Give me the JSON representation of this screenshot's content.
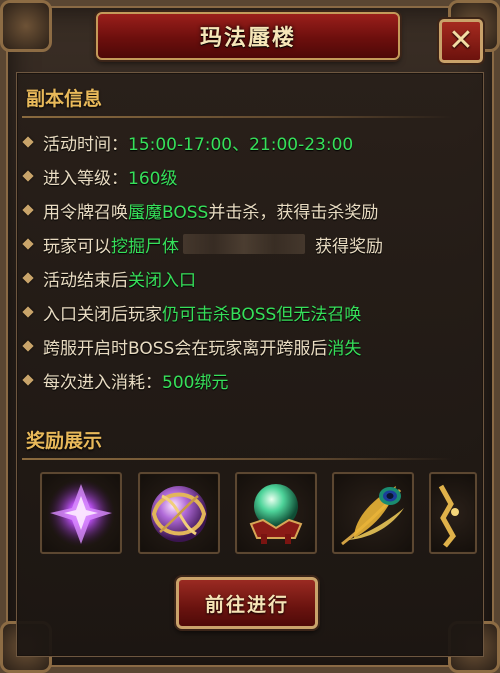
{
  "window": {
    "title": "玛法蜃楼",
    "close_label": "✕"
  },
  "info_section": {
    "title": "副本信息",
    "rows": [
      {
        "parts": [
          "活动时间：",
          "15:00-17:00、21:00-23:00"
        ]
      },
      {
        "parts": [
          "进入等级：",
          "160级"
        ]
      },
      {
        "parts": [
          "用令牌召唤",
          "蜃魔BOSS",
          "并击杀，获得击杀奖励"
        ]
      },
      {
        "parts": [
          "玩家可以",
          "挖掘尸体",
          "获得奖励"
        ]
      },
      {
        "parts": [
          "活动结束后",
          "关闭入口"
        ]
      },
      {
        "parts": [
          "入口关闭后玩家",
          "仍可击杀BOSS但无法召唤"
        ]
      },
      {
        "parts": [
          "跨服开启时BOSS会在玩家离开跨服后",
          "消失"
        ]
      },
      {
        "parts": [
          "每次进入消耗：",
          "500绑元"
        ]
      }
    ]
  },
  "reward_section": {
    "title": "奖励展示",
    "items": [
      {
        "icon": "purple-crystal-icon"
      },
      {
        "icon": "purple-orb-icon"
      },
      {
        "icon": "green-pearl-icon"
      },
      {
        "icon": "peacock-feather-icon"
      },
      {
        "icon": "golden-item-icon"
      }
    ]
  },
  "go_button": {
    "label": "前往进行"
  },
  "colors": {
    "highlight": "#36e05a",
    "section_title": "#e8b95a",
    "text": "#e9dcc2",
    "button_red": "#7a1712",
    "border_gold": "#caa36b"
  }
}
